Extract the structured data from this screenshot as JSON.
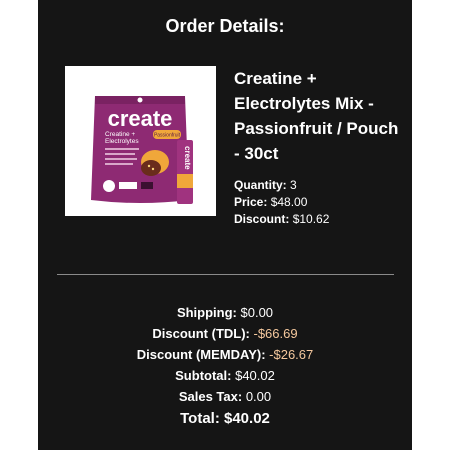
{
  "order": {
    "heading": "Order Details:",
    "product": {
      "brand_on_pack": "create",
      "pack_line1": "Creatine +",
      "pack_line2": "Electrolytes",
      "pack_flavor": "Passionfruit",
      "stick_brand": "create",
      "title": "Creatine + Electrolytes Mix - Passionfruit / Pouch - 30ct",
      "quantity_label": "Quantity:",
      "quantity_value": "3",
      "price_label": "Price:",
      "price_value": "$48.00",
      "discount_label": "Discount:",
      "discount_value": "$10.62"
    },
    "summary": {
      "shipping_label": "Shipping:",
      "shipping_value": "$0.00",
      "discount_tdl_label": "Discount (TDL):",
      "discount_tdl_value": "-$66.69",
      "discount_memday_label": "Discount (MEMDAY):",
      "discount_memday_value": "-$26.67",
      "subtotal_label": "Subtotal:",
      "subtotal_value": "$40.02",
      "sales_tax_label": "Sales Tax:",
      "sales_tax_value": "0.00",
      "total_label": "Total:",
      "total_value": "$40.02"
    }
  },
  "colors": {
    "panel_bg": "#151515",
    "negative_amount": "#f6c99e",
    "pouch": "#8e2a73"
  }
}
